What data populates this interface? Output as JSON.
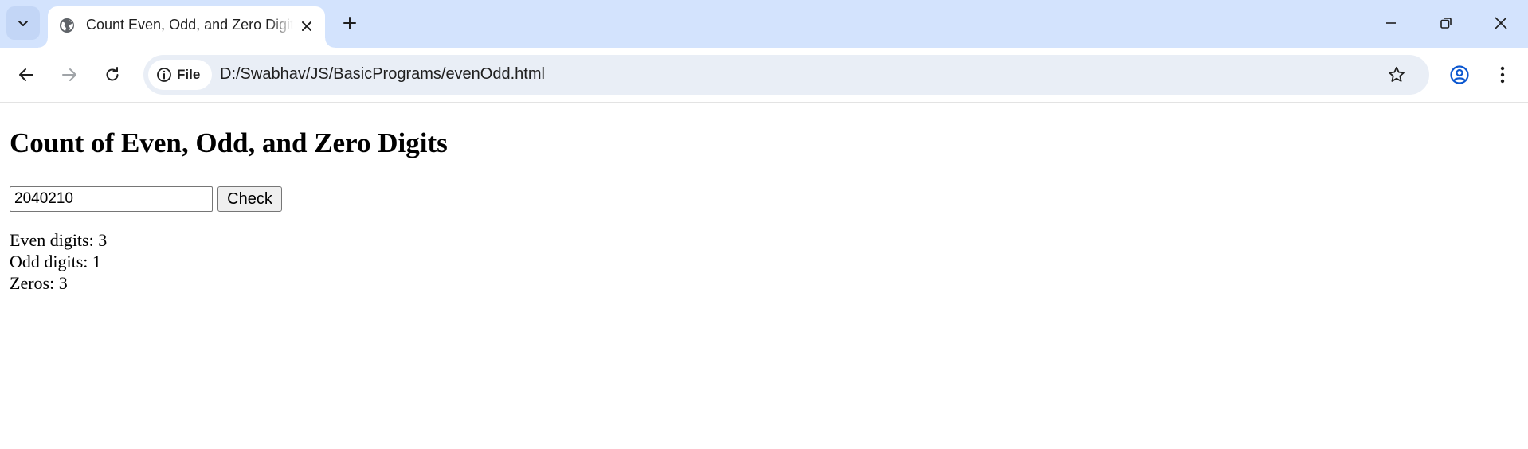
{
  "browser": {
    "tab": {
      "title": "Count Even, Odd, and Zero Digits",
      "favicon": "globe-icon"
    },
    "address_bar": {
      "site_chip_label": "File",
      "url": "D:/Swabhav/JS/BasicPrograms/evenOdd.html"
    },
    "colors": {
      "tabstrip_bg": "#d3e3fd",
      "omnibox_bg": "#e9eef6",
      "profile_accent": "#0b57d0"
    }
  },
  "page": {
    "heading": "Count of Even, Odd, and Zero Digits",
    "input_value": "2040210",
    "check_button_label": "Check",
    "results": {
      "even": "Even digits: 3",
      "odd": "Odd digits: 1",
      "zeros": "Zeros: 3"
    }
  }
}
